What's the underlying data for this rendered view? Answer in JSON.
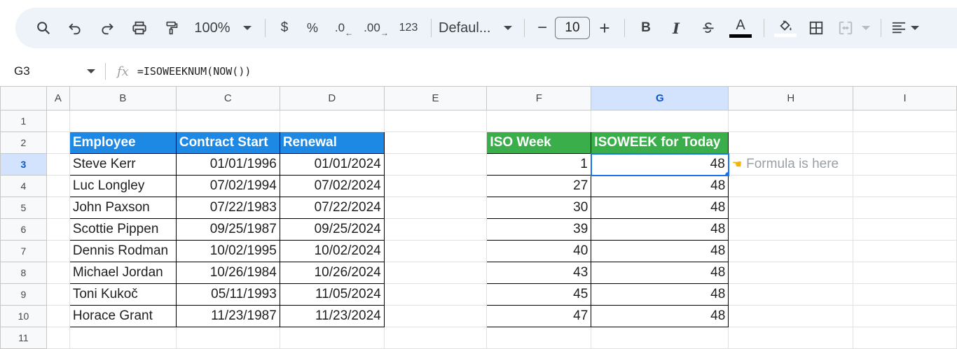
{
  "toolbar": {
    "zoom": "100%",
    "currency": "$",
    "percent": "%",
    "decrease_decimal": ".0",
    "increase_decimal": ".00",
    "number_format": "123",
    "font": "Defaul...",
    "font_size": "10",
    "minus": "−",
    "plus": "+",
    "bold": "B",
    "italic": "I",
    "text_color_letter": "A"
  },
  "formula_bar": {
    "cell_ref": "G3",
    "fx": "fx",
    "formula": "=ISOWEEKNUM(NOW())"
  },
  "columns": [
    "A",
    "B",
    "C",
    "D",
    "E",
    "F",
    "G",
    "H",
    "I"
  ],
  "rows": [
    "1",
    "2",
    "3",
    "4",
    "5",
    "6",
    "7",
    "8",
    "9",
    "10",
    "11"
  ],
  "table1": {
    "headers": [
      "Employee",
      "Contract Start",
      "Renewal"
    ],
    "rows": [
      [
        "Steve Kerr",
        "01/01/1996",
        "01/01/2024"
      ],
      [
        "Luc Longley",
        "07/02/1994",
        "07/02/2024"
      ],
      [
        "John Paxson",
        "07/22/1983",
        "07/22/2024"
      ],
      [
        "Scottie Pippen",
        "09/25/1987",
        "09/25/2024"
      ],
      [
        "Dennis Rodman",
        "10/02/1995",
        "10/02/2024"
      ],
      [
        "Michael Jordan",
        "10/26/1984",
        "10/26/2024"
      ],
      [
        "Toni Kukoč",
        "05/11/1993",
        "11/05/2024"
      ],
      [
        "Horace Grant",
        "11/23/1987",
        "11/23/2024"
      ]
    ]
  },
  "table2": {
    "headers": [
      "ISO Week",
      "ISOWEEK for Today"
    ],
    "rows": [
      [
        "1",
        "48"
      ],
      [
        "27",
        "48"
      ],
      [
        "30",
        "48"
      ],
      [
        "39",
        "48"
      ],
      [
        "40",
        "48"
      ],
      [
        "43",
        "48"
      ],
      [
        "45",
        "48"
      ],
      [
        "47",
        "48"
      ]
    ]
  },
  "note": "Formula is here",
  "colors": {
    "header_blue": "#1e88e5",
    "header_green": "#3aae4a",
    "selection": "#1a73e8"
  }
}
